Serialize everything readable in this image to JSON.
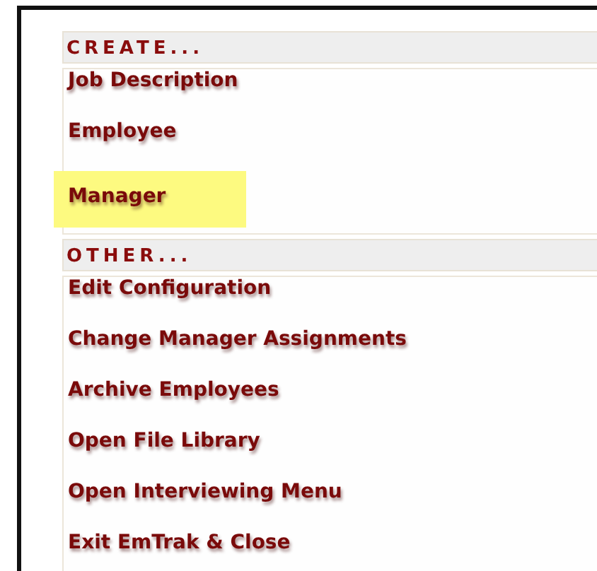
{
  "sections": [
    {
      "heading": "CREATE...",
      "items": [
        {
          "label": "Job Description",
          "highlighted": false
        },
        {
          "label": "Employee",
          "highlighted": false
        },
        {
          "label": "Manager",
          "highlighted": true
        }
      ]
    },
    {
      "heading": "OTHER...",
      "items": [
        {
          "label": "Edit Configuration",
          "highlighted": false
        },
        {
          "label": "Change Manager Assignments",
          "highlighted": false
        },
        {
          "label": "Archive Employees",
          "highlighted": false
        },
        {
          "label": "Open File Library",
          "highlighted": false
        },
        {
          "label": "Open Interviewing Menu",
          "highlighted": false
        },
        {
          "label": "Exit EmTrak & Close",
          "highlighted": false
        }
      ]
    }
  ]
}
